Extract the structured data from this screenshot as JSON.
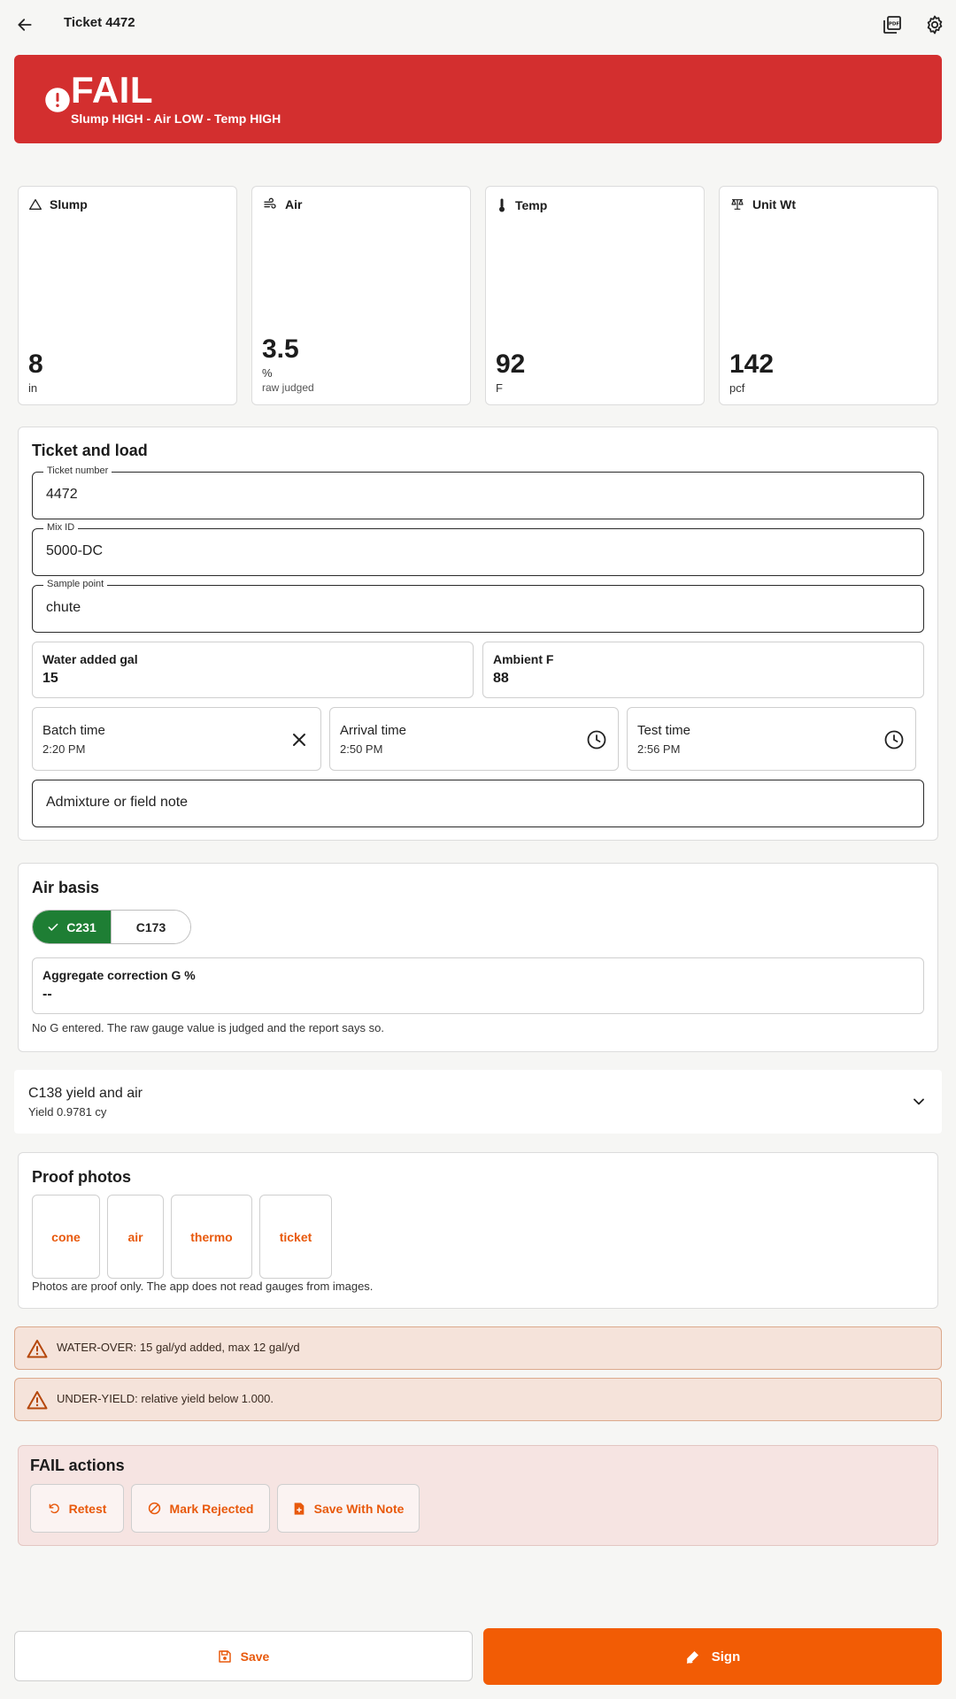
{
  "header": {
    "title": "Ticket 4472"
  },
  "banner": {
    "status": "FAIL",
    "detail": "Slump HIGH - Air LOW - Temp HIGH",
    "color": "#d32f2f"
  },
  "metrics": [
    {
      "label": "Slump",
      "value": "8",
      "unit": "in",
      "icon": "triangle-icon"
    },
    {
      "label": "Air",
      "value": "3.5",
      "unit": "%",
      "sub": "raw judged",
      "icon": "air-icon"
    },
    {
      "label": "Temp",
      "value": "92",
      "unit": "F",
      "icon": "thermometer-icon"
    },
    {
      "label": "Unit Wt",
      "value": "142",
      "unit": "pcf",
      "icon": "scale-icon"
    }
  ],
  "ticket": {
    "title": "Ticket and load",
    "ticket_number": {
      "label": "Ticket number",
      "value": "4472"
    },
    "mix_id": {
      "label": "Mix ID",
      "value": "5000-DC"
    },
    "sample_point": {
      "label": "Sample point",
      "value": "chute"
    },
    "water_added": {
      "label": "Water added gal",
      "value": "15"
    },
    "ambient": {
      "label": "Ambient F",
      "value": "88"
    },
    "batch_time": {
      "label": "Batch time",
      "value": "2:20 PM"
    },
    "arrival_time": {
      "label": "Arrival time",
      "value": "2:50 PM"
    },
    "test_time": {
      "label": "Test time",
      "value": "2:56 PM"
    },
    "note_placeholder": "Admixture or field note"
  },
  "air_basis": {
    "title": "Air basis",
    "options": [
      "C231",
      "C173"
    ],
    "selected": "C231",
    "correction": {
      "label": "Aggregate correction G %",
      "value": "--"
    },
    "note": "No G entered. The raw gauge value is judged and the report says so."
  },
  "yield": {
    "title": "C138 yield and air",
    "subtitle": "Yield 0.9781 cy"
  },
  "photos": {
    "title": "Proof photos",
    "items": [
      "cone",
      "air",
      "thermo",
      "ticket"
    ],
    "note": "Photos are proof only. The app does not read gauges from images."
  },
  "warnings": [
    "WATER-OVER: 15 gal/yd added, max 12 gal/yd",
    "UNDER-YIELD: relative yield below 1.000."
  ],
  "fail_actions": {
    "title": "FAIL actions",
    "buttons": [
      "Retest",
      "Mark Rejected",
      "Save With Note"
    ]
  },
  "footer": {
    "save": "Save",
    "sign": "Sign"
  },
  "colors": {
    "accent": "#f25c05",
    "pass_green": "#1e7e34",
    "fail_red": "#d32f2f"
  }
}
